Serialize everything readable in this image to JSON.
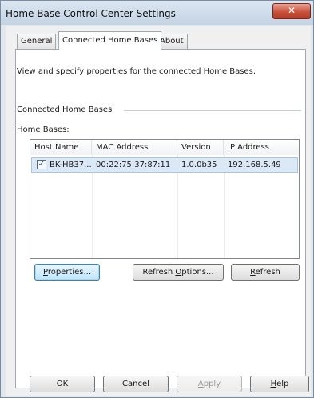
{
  "window": {
    "title": "Home Base Control Center Settings",
    "close_glyph": "✕"
  },
  "tabs": [
    {
      "label": "General"
    },
    {
      "label": "Connected Home Bases"
    },
    {
      "label": "About"
    }
  ],
  "panel": {
    "description": "View and specify properties for the connected Home Bases.",
    "group_label": "Connected Home Bases",
    "list_label_mnemonic": "H",
    "list_label_rest": "ome Bases:"
  },
  "listview": {
    "columns": [
      "Host Name",
      "MAC Address",
      "Version",
      "IP Address"
    ],
    "rows": [
      {
        "checked": true,
        "check_glyph": "✓",
        "host": "BK-HB37...",
        "mac": "00:22:75:37:87:11",
        "version": "1.0.0b35",
        "ip": "192.168.5.49"
      }
    ]
  },
  "actions": {
    "properties_mnemonic": "P",
    "properties_rest": "roperties...",
    "refresh_options_prefix": "Refresh ",
    "refresh_options_mnemonic": "O",
    "refresh_options_rest": "ptions...",
    "refresh_mnemonic": "R",
    "refresh_rest": "efresh"
  },
  "footer": {
    "ok": "OK",
    "cancel": "Cancel",
    "apply_mnemonic": "A",
    "apply_rest": "pply",
    "help_mnemonic": "H",
    "help_rest": "elp"
  }
}
